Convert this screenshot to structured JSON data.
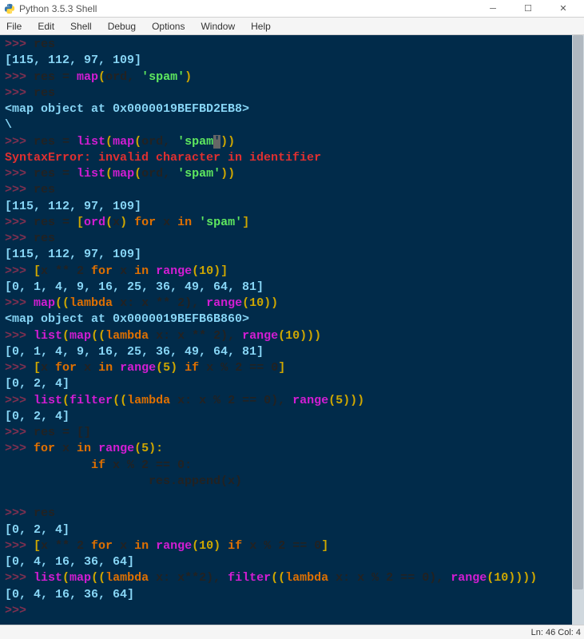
{
  "window": {
    "title": "Python 3.5.3 Shell"
  },
  "menu": {
    "items": [
      "File",
      "Edit",
      "Shell",
      "Debug",
      "Options",
      "Window",
      "Help"
    ]
  },
  "status": {
    "pos": "Ln: 46   Col: 4"
  },
  "code": {
    "l1_prompt": ">>> ",
    "l1_var": "res",
    "l2_out": "[115, 112, 97, 109]",
    "l3_prompt": ">>> ",
    "l3_a": "res = ",
    "l3_func": "map",
    "l3_p1": "(",
    "l3_arg": "ord",
    "l3_c": ", ",
    "l3_str": "'spam'",
    "l3_p2": ")",
    "l4_prompt": ">>> ",
    "l4_var": "res",
    "l5_out": "<map object at 0x0000019BEFBD2EB8>",
    "l6_out": "\\",
    "l7_prompt": ">>> ",
    "l7_a": "res = ",
    "l7_f1": "list",
    "l7_p1": "(",
    "l7_f2": "map",
    "l7_p2": "(",
    "l7_arg": "ord",
    "l7_c": ", ",
    "l7_s1": "'spam",
    "l7_caret": "'",
    "l7_pp": "))",
    "l8_err": "SyntaxError: invalid character in identifier",
    "l9_prompt": ">>> ",
    "l9_a": "res = ",
    "l9_f1": "list",
    "l9_p1": "(",
    "l9_f2": "map",
    "l9_p2": "(",
    "l9_arg": "ord",
    "l9_c": ", ",
    "l9_str": "'spam'",
    "l9_pp": "))",
    "l10_prompt": ">>> ",
    "l10_var": "res",
    "l11_out": "[115, 112, 97, 109]",
    "l12_prompt": ">>> ",
    "l12_a": "res = ",
    "l12_b1": "[",
    "l12_f": "ord",
    "l12_p1": "(",
    "l12_x": "x",
    "l12_p2": ") ",
    "l12_for": "for",
    "l12_x2": " x ",
    "l12_in": "in",
    "l12_sp": " ",
    "l12_str": "'spam'",
    "l12_b2": "]",
    "l13_prompt": ">>> ",
    "l13_var": "res",
    "l14_out": "[115, 112, 97, 109]",
    "l15_prompt": ">>> ",
    "l15_b1": "[",
    "l15_expr": "x ** 2 ",
    "l15_for": "for",
    "l15_x": " x ",
    "l15_in": "in",
    "l15_sp": " ",
    "l15_f": "range",
    "l15_p1": "(",
    "l15_n": "10",
    "l15_p2": ")]",
    "l16_out": "[0, 1, 4, 9, 16, 25, 36, 49, 64, 81]",
    "l17_prompt": ">>> ",
    "l17_f": "map",
    "l17_p1": "((",
    "l17_lam": "lambda",
    "l17_body": " x: x ** 2), ",
    "l17_r": "range",
    "l17_p2": "(",
    "l17_n": "10",
    "l17_p3": "))",
    "l18_out": "<map object at 0x0000019BEFB6B860>",
    "l19_prompt": ">>> ",
    "l19_f1": "list",
    "l19_p1": "(",
    "l19_f2": "map",
    "l19_p2": "((",
    "l19_lam": "lambda",
    "l19_body": " x: x ** 2), ",
    "l19_r": "range",
    "l19_p3": "(",
    "l19_n": "10",
    "l19_p4": ")))",
    "l20_out": "[0, 1, 4, 9, 16, 25, 36, 49, 64, 81]",
    "l21_prompt": ">>> ",
    "l21_b1": "[",
    "l21_x": "x ",
    "l21_for": "for",
    "l21_x2": " x ",
    "l21_in": "in",
    "l21_sp": " ",
    "l21_f": "range",
    "l21_p1": "(",
    "l21_n": "5",
    "l21_p2": ") ",
    "l21_if": "if",
    "l21_cond": " x % 2 == 0",
    "l21_b2": "]",
    "l22_out": "[0, 2, 4]",
    "l23_prompt": ">>> ",
    "l23_f1": "list",
    "l23_p1": "(",
    "l23_f2": "filter",
    "l23_p2": "((",
    "l23_lam": "lambda",
    "l23_body": " x: x % 2 == 0), ",
    "l23_r": "range",
    "l23_p3": "(",
    "l23_n": "5",
    "l23_p4": ")))",
    "l24_out": "[0, 2, 4]",
    "l25_prompt": ">>> ",
    "l25_a": "res = []",
    "l26_prompt": ">>> ",
    "l26_for": "for",
    "l26_x": " x ",
    "l26_in": "in",
    "l26_sp": " ",
    "l26_f": "range",
    "l26_p1": "(",
    "l26_n": "5",
    "l26_p2": "):",
    "l27_indent": "            ",
    "l27_if": "if",
    "l27_cond": " x % 2 == 0:",
    "l28_indent": "                    ",
    "l28_body": "res.append(x)",
    "l29_blank": " ",
    "l30_prompt": ">>> ",
    "l30_var": "res",
    "l31_out": "[0, 2, 4]",
    "l32_prompt": ">>> ",
    "l32_b1": "[",
    "l32_expr": "x ** 2 ",
    "l32_for": "for",
    "l32_x": " x ",
    "l32_in": "in",
    "l32_sp": " ",
    "l32_f": "range",
    "l32_p1": "(",
    "l32_n": "10",
    "l32_p2": ") ",
    "l32_if": "if",
    "l32_cond": " x % 2 == 0",
    "l32_b2": "]",
    "l33_out": "[0, 4, 16, 36, 64]",
    "l34_prompt": ">>> ",
    "l34_f1": "list",
    "l34_p1": "(",
    "l34_f2": "map",
    "l34_p2": "((",
    "l34_lam1": "lambda",
    "l34_b1": " x: x**2), ",
    "l34_f3": "filter",
    "l34_p3": "((",
    "l34_lam2": "lambda",
    "l34_b2": " x: x % 2 == 0), ",
    "l34_r": "range",
    "l34_p4": "(",
    "l34_n": "10",
    "l34_p5": "))))",
    "l35_out": "[0, 4, 16, 36, 64]",
    "l36_prompt": ">>> "
  }
}
